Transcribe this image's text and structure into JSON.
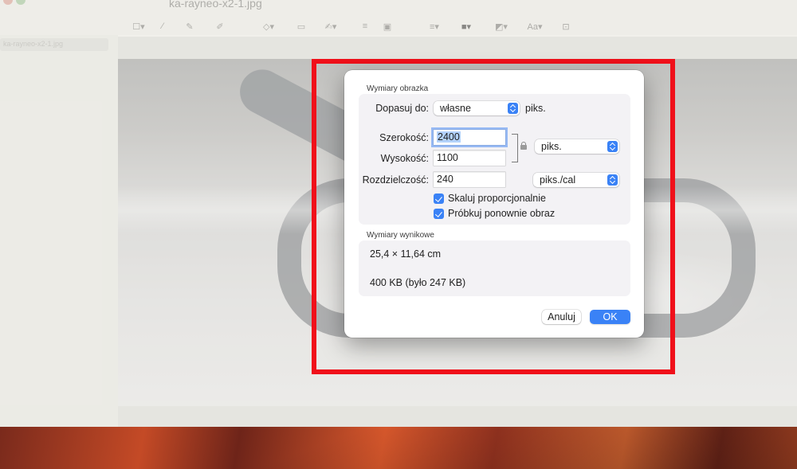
{
  "app": {
    "document_title": "ka-rayneo-x2-1.jpg",
    "sidebar_item": "ka-rayneo-x2-1.jpg"
  },
  "dialog": {
    "image_dimensions_title": "Wymiary obrazka",
    "fit_to_label": "Dopasuj do:",
    "fit_to_value": "własne",
    "fit_to_unit": "piks.",
    "width_label": "Szerokość:",
    "width_value": "2400",
    "height_label": "Wysokość:",
    "height_value": "1100",
    "size_unit_value": "piks.",
    "resolution_label": "Rozdzielczość:",
    "resolution_value": "240",
    "resolution_unit_value": "piks./cal",
    "scale_proportionally_label": "Skaluj proporcjonalnie",
    "scale_proportionally_checked": true,
    "resample_label": "Próbkuj ponownie obraz",
    "resample_checked": true,
    "result_title": "Wymiary wynikowe",
    "result_size": "25,4 × 11,64 cm",
    "result_file_size": "400 KB (było 247 KB)",
    "cancel_label": "Anuluj",
    "ok_label": "OK"
  },
  "colors": {
    "accent": "#3a82f6",
    "highlight": "#f0101a"
  }
}
